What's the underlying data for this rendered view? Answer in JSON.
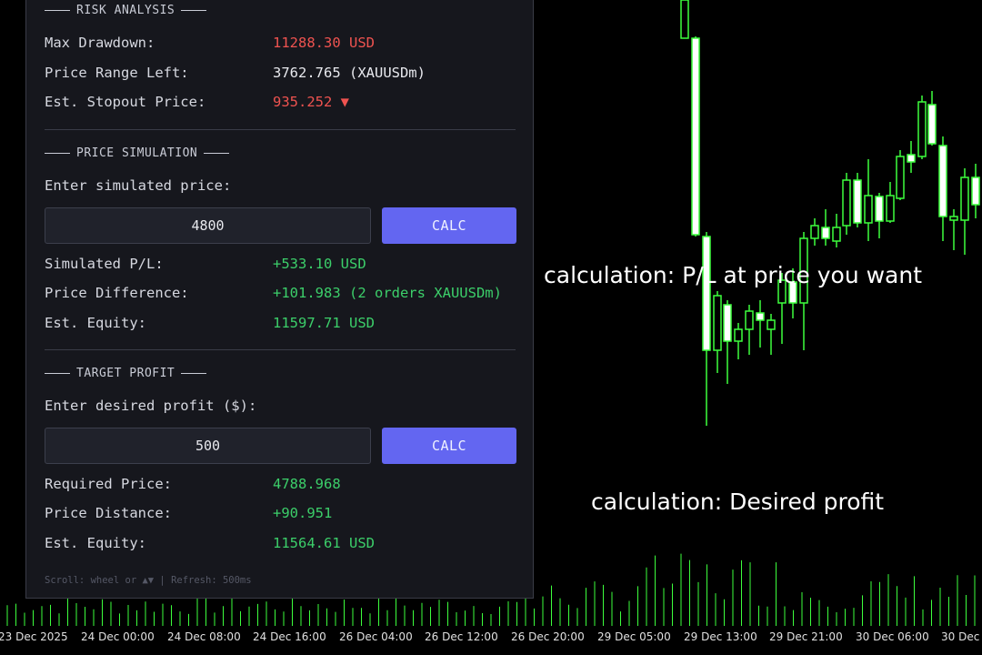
{
  "risk": {
    "title": "RISK ANALYSIS",
    "rows": [
      {
        "label": "Max Drawdown:",
        "value": "11288.30 USD"
      },
      {
        "label": "Price Range Left:",
        "value": "3762.765 (XAUUSDm)"
      },
      {
        "label": "Est. Stopout Price:",
        "value": "935.252 ▼"
      }
    ]
  },
  "simulation": {
    "title": "PRICE SIMULATION",
    "prompt": "Enter simulated price:",
    "input_value": "4800",
    "button": "CALC",
    "rows": [
      {
        "label": "Simulated P/L:",
        "value": "+533.10 USD"
      },
      {
        "label": "Price Difference:",
        "value": "+101.983 (2 orders XAUUSDm)"
      },
      {
        "label": "Est. Equity:",
        "value": "11597.71 USD"
      }
    ]
  },
  "target": {
    "title": "TARGET PROFIT",
    "prompt": "Enter desired profit ($):",
    "input_value": "500",
    "button": "CALC",
    "rows": [
      {
        "label": "Required Price:",
        "value": "4788.968"
      },
      {
        "label": "Price Distance:",
        "value": "+90.951"
      },
      {
        "label": "Est. Equity:",
        "value": "11564.61 USD"
      }
    ]
  },
  "footer": "Scroll: wheel or ▲▼  |  Refresh: 500ms",
  "annotations": {
    "pl": "calculation: P/L at price you want",
    "profit": "calculation: Desired profit"
  },
  "time_axis": [
    "23 Dec 2025",
    "24 Dec 00:00",
    "24 Dec 08:00",
    "24 Dec 16:00",
    "26 Dec 04:00",
    "26 Dec 12:00",
    "26 Dec 20:00",
    "29 Dec 05:00",
    "29 Dec 13:00",
    "29 Dec 21:00",
    "30 Dec 06:00",
    "30 Dec"
  ],
  "colors": {
    "background": "#000000",
    "candle": "#3dff3d",
    "bull_body": "#ffffff",
    "accent_button": "#6366f1",
    "negative": "#ef5350",
    "positive": "#3ccf6a"
  }
}
